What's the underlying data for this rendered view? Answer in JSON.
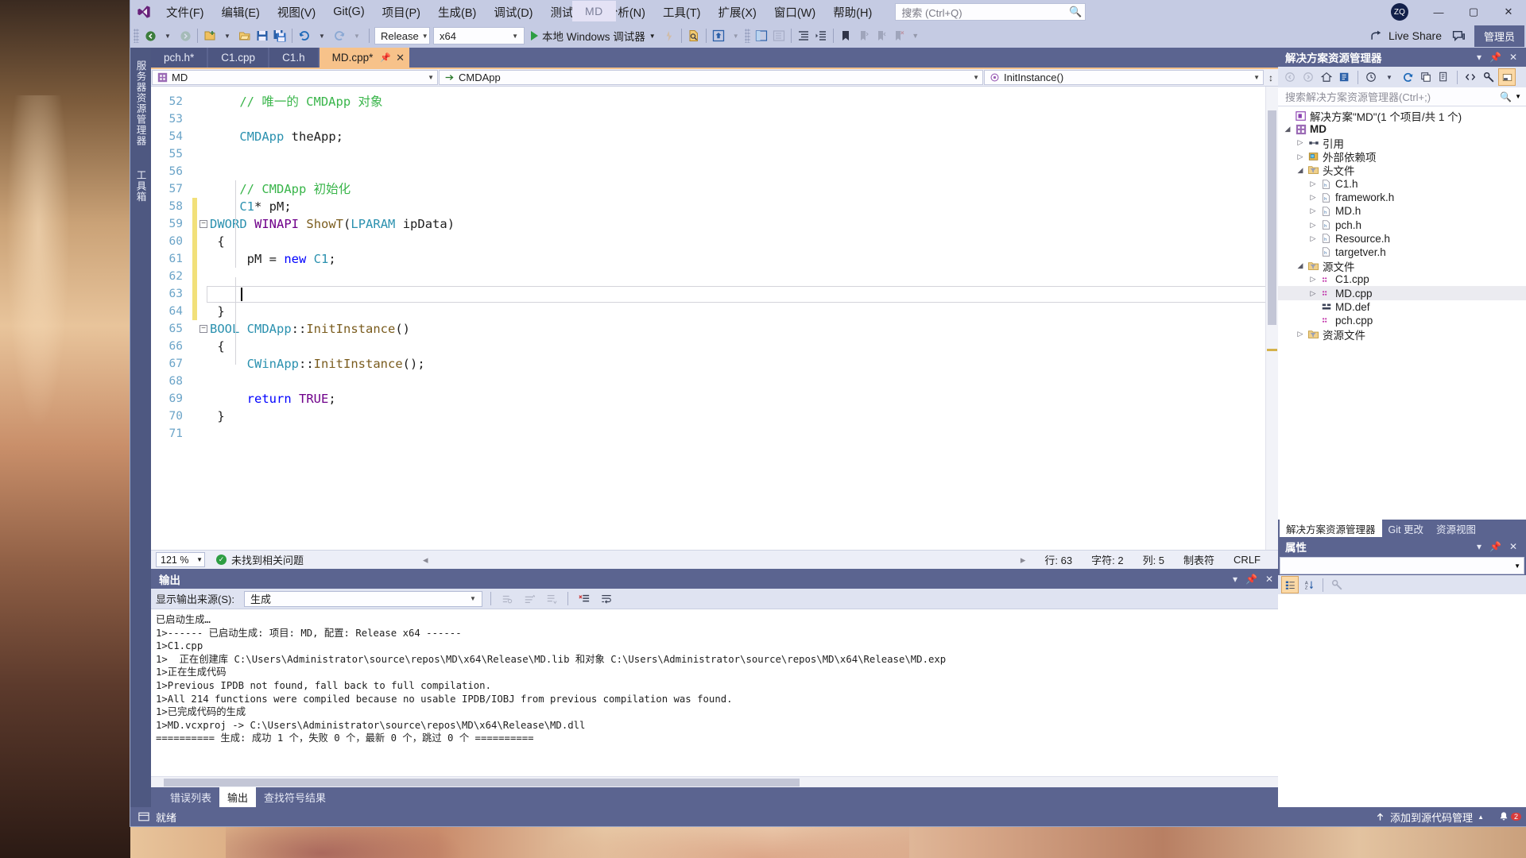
{
  "app": {
    "title": "MD",
    "avatar_initials": "ZQ",
    "logo_name": "visual-studio-logo"
  },
  "menu": {
    "items": [
      {
        "label": "文件(F)"
      },
      {
        "label": "编辑(E)"
      },
      {
        "label": "视图(V)"
      },
      {
        "label": "Git(G)"
      },
      {
        "label": "项目(P)"
      },
      {
        "label": "生成(B)"
      },
      {
        "label": "调试(D)"
      },
      {
        "label": "测试(S)"
      },
      {
        "label": "分析(N)"
      },
      {
        "label": "工具(T)"
      },
      {
        "label": "扩展(X)"
      },
      {
        "label": "窗口(W)"
      },
      {
        "label": "帮助(H)"
      }
    ],
    "search_placeholder": "搜索 (Ctrl+Q)"
  },
  "window_buttons": {
    "minimize": "—",
    "maximize": "▢",
    "close": "✕"
  },
  "toolbar": {
    "config": "Release",
    "platform": "x64",
    "run_label": "本地 Windows 调试器",
    "live_share": "Live Share",
    "admin": "管理员"
  },
  "doc_tabs": [
    {
      "label": "pch.h*",
      "active": false
    },
    {
      "label": "C1.cpp",
      "active": false
    },
    {
      "label": "C1.h",
      "active": false
    },
    {
      "label": "MD.cpp*",
      "active": true
    }
  ],
  "vertical_tabs": [
    {
      "label": "服务器资源管理器"
    },
    {
      "label": "工具箱"
    }
  ],
  "navbar": {
    "project": "MD",
    "type": "CMDApp",
    "member": "InitInstance()"
  },
  "code": {
    "lines": [
      {
        "num": "52",
        "changed": false,
        "fold": "",
        "tokens": [
          {
            "t": "    ",
            "c": "plain"
          },
          {
            "t": "// 唯一的 CMDApp 对象",
            "c": "cmt"
          }
        ]
      },
      {
        "num": "53",
        "changed": false,
        "fold": "",
        "tokens": []
      },
      {
        "num": "54",
        "changed": false,
        "fold": "",
        "tokens": [
          {
            "t": "    ",
            "c": "plain"
          },
          {
            "t": "CMDApp",
            "c": "typ"
          },
          {
            "t": " theApp;",
            "c": "plain"
          }
        ]
      },
      {
        "num": "55",
        "changed": false,
        "fold": "",
        "tokens": []
      },
      {
        "num": "56",
        "changed": false,
        "fold": "",
        "tokens": []
      },
      {
        "num": "57",
        "changed": false,
        "fold": "",
        "tokens": [
          {
            "t": "    ",
            "c": "plain"
          },
          {
            "t": "// CMDApp 初始化",
            "c": "cmt"
          }
        ]
      },
      {
        "num": "58",
        "changed": true,
        "fold": "",
        "tokens": [
          {
            "t": "    ",
            "c": "plain"
          },
          {
            "t": "C1",
            "c": "typ"
          },
          {
            "t": "* pM;",
            "c": "plain"
          }
        ]
      },
      {
        "num": "59",
        "changed": true,
        "fold": "minus",
        "tokens": [
          {
            "t": "DWORD",
            "c": "typ"
          },
          {
            "t": " ",
            "c": "plain"
          },
          {
            "t": "WINAPI",
            "c": "mac"
          },
          {
            "t": " ",
            "c": "plain"
          },
          {
            "t": "ShowT",
            "c": "fn"
          },
          {
            "t": "(",
            "c": "plain"
          },
          {
            "t": "LPARAM",
            "c": "typ"
          },
          {
            "t": " ipData)",
            "c": "plain"
          }
        ]
      },
      {
        "num": "60",
        "changed": true,
        "fold": "",
        "tokens": [
          {
            "t": " {",
            "c": "plain"
          }
        ]
      },
      {
        "num": "61",
        "changed": true,
        "fold": "",
        "tokens": [
          {
            "t": "     pM = ",
            "c": "plain"
          },
          {
            "t": "new",
            "c": "kw"
          },
          {
            "t": " ",
            "c": "plain"
          },
          {
            "t": "C1",
            "c": "typ"
          },
          {
            "t": ";",
            "c": "plain"
          }
        ]
      },
      {
        "num": "62",
        "changed": true,
        "fold": "",
        "tokens": []
      },
      {
        "num": "63",
        "changed": true,
        "fold": "",
        "tokens": [],
        "current": true
      },
      {
        "num": "64",
        "changed": true,
        "fold": "",
        "tokens": [
          {
            "t": " }",
            "c": "plain"
          }
        ]
      },
      {
        "num": "65",
        "changed": false,
        "fold": "minus",
        "tokens": [
          {
            "t": "BOOL",
            "c": "typ"
          },
          {
            "t": " ",
            "c": "plain"
          },
          {
            "t": "CMDApp",
            "c": "typ"
          },
          {
            "t": "::",
            "c": "plain"
          },
          {
            "t": "InitInstance",
            "c": "fn"
          },
          {
            "t": "()",
            "c": "plain"
          }
        ]
      },
      {
        "num": "66",
        "changed": false,
        "fold": "",
        "tokens": [
          {
            "t": " {",
            "c": "plain"
          }
        ]
      },
      {
        "num": "67",
        "changed": false,
        "fold": "",
        "tokens": [
          {
            "t": "     ",
            "c": "plain"
          },
          {
            "t": "CWinApp",
            "c": "typ"
          },
          {
            "t": "::",
            "c": "plain"
          },
          {
            "t": "InitInstance",
            "c": "fn"
          },
          {
            "t": "();",
            "c": "plain"
          }
        ]
      },
      {
        "num": "68",
        "changed": false,
        "fold": "",
        "tokens": []
      },
      {
        "num": "69",
        "changed": false,
        "fold": "",
        "tokens": [
          {
            "t": "     ",
            "c": "plain"
          },
          {
            "t": "return",
            "c": "kw"
          },
          {
            "t": " ",
            "c": "plain"
          },
          {
            "t": "TRUE",
            "c": "mac"
          },
          {
            "t": ";",
            "c": "plain"
          }
        ]
      },
      {
        "num": "70",
        "changed": false,
        "fold": "",
        "tokens": [
          {
            "t": " }",
            "c": "plain"
          }
        ]
      },
      {
        "num": "71",
        "changed": false,
        "fold": "",
        "tokens": []
      }
    ]
  },
  "editor_status": {
    "zoom": "121 %",
    "issues": "未找到相关问题",
    "line_label": "行: 63",
    "char_label": "字符: 2",
    "col_label": "列: 5",
    "tabs_label": "制表符",
    "eol": "CRLF"
  },
  "output": {
    "title": "输出",
    "source_label": "显示输出来源(S):",
    "source_value": "生成",
    "lines": [
      "已启动生成…",
      "1>------ 已启动生成: 项目: MD, 配置: Release x64 ------",
      "1>C1.cpp",
      "1>  正在创建库 C:\\Users\\Administrator\\source\\repos\\MD\\x64\\Release\\MD.lib 和对象 C:\\Users\\Administrator\\source\\repos\\MD\\x64\\Release\\MD.exp",
      "1>正在生成代码",
      "1>Previous IPDB not found, fall back to full compilation.",
      "1>All 214 functions were compiled because no usable IPDB/IOBJ from previous compilation was found.",
      "1>已完成代码的生成",
      "1>MD.vcxproj -> C:\\Users\\Administrator\\source\\repos\\MD\\x64\\Release\\MD.dll",
      "========== 生成: 成功 1 个，失败 0 个，最新 0 个，跳过 0 个 =========="
    ],
    "tabs": [
      {
        "label": "错误列表",
        "active": false
      },
      {
        "label": "输出",
        "active": true
      },
      {
        "label": "查找符号结果",
        "active": false
      }
    ]
  },
  "solution_explorer": {
    "title": "解决方案资源管理器",
    "search_placeholder": "搜索解决方案资源管理器(Ctrl+;)",
    "tree": [
      {
        "depth": 0,
        "arrow": "",
        "icon": "solution-icon",
        "label": "解决方案\"MD\"(1 个项目/共 1 个)",
        "selected": false
      },
      {
        "depth": 0,
        "arrow": "down",
        "icon": "project-icon",
        "label": "MD",
        "bold": true,
        "selected": false
      },
      {
        "depth": 1,
        "arrow": "right",
        "icon": "references-icon",
        "label": "引用",
        "selected": false
      },
      {
        "depth": 1,
        "arrow": "right",
        "icon": "ext-dep-icon",
        "label": "外部依赖项",
        "selected": false
      },
      {
        "depth": 1,
        "arrow": "down",
        "icon": "filter-folder-icon",
        "label": "头文件",
        "selected": false
      },
      {
        "depth": 2,
        "arrow": "right",
        "icon": "header-file-icon",
        "label": "C1.h",
        "selected": false
      },
      {
        "depth": 2,
        "arrow": "right",
        "icon": "header-file-icon",
        "label": "framework.h",
        "selected": false
      },
      {
        "depth": 2,
        "arrow": "right",
        "icon": "header-file-icon",
        "label": "MD.h",
        "selected": false
      },
      {
        "depth": 2,
        "arrow": "right",
        "icon": "header-file-icon",
        "label": "pch.h",
        "selected": false
      },
      {
        "depth": 2,
        "arrow": "right",
        "icon": "header-file-icon",
        "label": "Resource.h",
        "selected": false
      },
      {
        "depth": 2,
        "arrow": "",
        "icon": "header-file-icon",
        "label": "targetver.h",
        "selected": false
      },
      {
        "depth": 1,
        "arrow": "down",
        "icon": "filter-folder-icon",
        "label": "源文件",
        "selected": false
      },
      {
        "depth": 2,
        "arrow": "right",
        "icon": "cpp-file-icon",
        "label": "C1.cpp",
        "selected": false
      },
      {
        "depth": 2,
        "arrow": "right",
        "icon": "cpp-file-icon",
        "label": "MD.cpp",
        "selected": true
      },
      {
        "depth": 2,
        "arrow": "",
        "icon": "def-file-icon",
        "label": "MD.def",
        "selected": false
      },
      {
        "depth": 2,
        "arrow": "",
        "icon": "cpp-file-icon",
        "label": "pch.cpp",
        "selected": false
      },
      {
        "depth": 1,
        "arrow": "right",
        "icon": "filter-folder-icon",
        "label": "资源文件",
        "selected": false
      }
    ],
    "tabs": [
      {
        "label": "解决方案资源管理器",
        "active": true
      },
      {
        "label": "Git 更改",
        "active": false
      },
      {
        "label": "资源视图",
        "active": false
      }
    ]
  },
  "properties": {
    "title": "属性"
  },
  "statusbar": {
    "ready": "就绪",
    "source_control": "添加到源代码管理",
    "notification_count": "2"
  },
  "colors": {
    "accent": "#5b6490",
    "active_tab": "#f7c28a",
    "chrome": "#c5cbe3",
    "comment_green": "#39b54a",
    "type_blue": "#2b91af",
    "keyword_blue": "#0000ff",
    "macro_purple": "#6f008a"
  }
}
